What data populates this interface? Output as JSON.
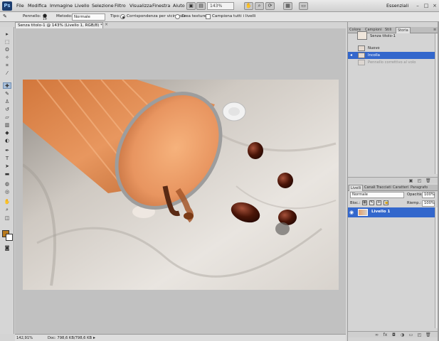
{
  "app": {
    "logo": "Ps"
  },
  "menubar": {
    "items": [
      "File",
      "Modifica",
      "Immagine",
      "Livello",
      "Selezione",
      "Filtro",
      "Visualizza",
      "Finestra",
      "Aiuto"
    ],
    "zoom": "143%",
    "workspace": "Essenziali"
  },
  "options": {
    "brush_label": "Pennello:",
    "brush_size": "19",
    "mode_label": "Metodo:",
    "mode_value": "Normale",
    "type_label": "Tipo:",
    "radio_proximity": "Corrispondenza per vicinanza",
    "radio_texture": "Crea texture",
    "sample_all": "Campiona tutti i livelli"
  },
  "document": {
    "tab_title": "Senza titolo-1 @ 143% (Livello 1, RGB/8) *",
    "close": "×",
    "zoom_status": "142,91%",
    "doc_status": "Doc: 798,6 KB/798,6 KB"
  },
  "history_panel": {
    "tabs": [
      "Colore",
      "Campioni",
      "Stili",
      "Storia"
    ],
    "active_tab": "Storia",
    "snapshot": "Senza titolo-1",
    "steps": [
      {
        "label": "Nuovo",
        "state": "normal"
      },
      {
        "label": "Incolla",
        "state": "selected"
      },
      {
        "label": "Pennello correttivo al volo",
        "state": "dimmed"
      }
    ]
  },
  "layers_panel": {
    "tabs": [
      "Livelli",
      "Canali",
      "Tracciati",
      "Caratteri",
      "Paragrafo"
    ],
    "active_tab": "Livelli",
    "blend_mode": "Normale",
    "opacity_label": "Opacità:",
    "opacity_value": "100%",
    "lock_label": "Bloc.:",
    "fill_label": "Riemp.:",
    "fill_value": "100%",
    "layer_name": "Livello 1"
  },
  "colors": {
    "foreground": "#b87a1e",
    "background": "#ffffff",
    "selection": "#3367cc"
  }
}
